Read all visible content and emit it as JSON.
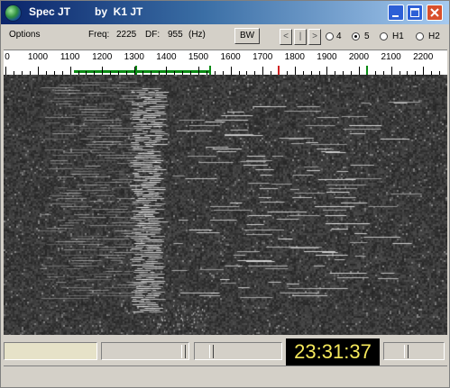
{
  "window": {
    "title": "Spec JT",
    "author": "by  K1 JT"
  },
  "menu": {
    "options": "Options",
    "freq_label": "Freq:",
    "freq_value": "2225",
    "df_label": "DF:",
    "df_value": "955",
    "df_unit": "(Hz)",
    "bw_button": "BW",
    "nav_left": "<",
    "nav_mid": "|",
    "nav_right": ">"
  },
  "speed_options": [
    {
      "label": "4",
      "selected": false
    },
    {
      "label": "5",
      "selected": true
    },
    {
      "label": "H1",
      "selected": false
    },
    {
      "label": "H2",
      "selected": false
    }
  ],
  "ruler": {
    "partial_left": "0",
    "labels": [
      "1000",
      "1100",
      "1200",
      "1300",
      "1400",
      "1500",
      "1600",
      "1700",
      "1800",
      "1900",
      "2000",
      "2100",
      "2200"
    ],
    "passband_color": "#0a8a14",
    "marker_colors": {
      "green": "#0a8a14",
      "red": "#d02020"
    }
  },
  "status": {
    "clock": "23:31:37",
    "clock_color": "#f5e85c"
  }
}
